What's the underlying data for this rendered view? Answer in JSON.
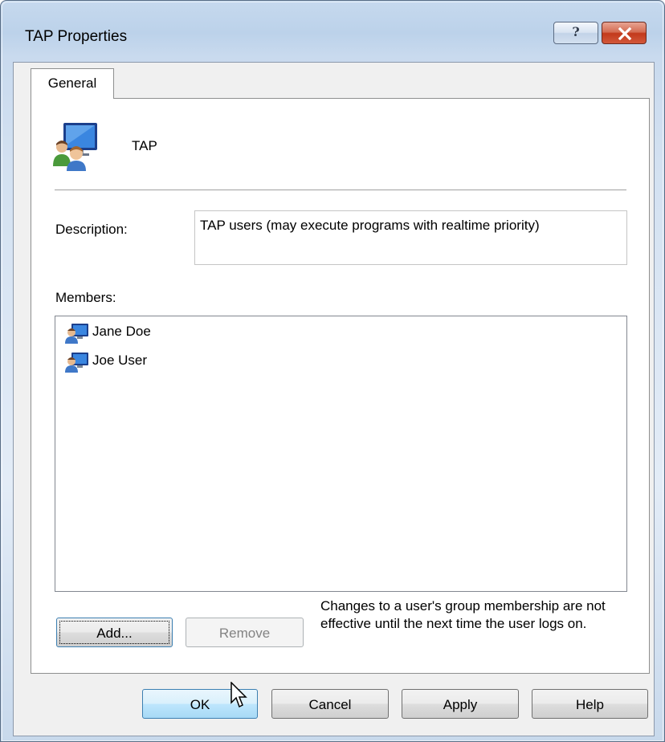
{
  "window": {
    "title": "TAP Properties",
    "help_button": "?",
    "close_icon": "close-icon"
  },
  "tabs": [
    {
      "label": "General",
      "selected": true
    }
  ],
  "group": {
    "icon": "users-group-icon",
    "name": "TAP"
  },
  "description": {
    "label": "Description:",
    "value": "TAP users (may execute programs with realtime priority)"
  },
  "members": {
    "label": "Members:",
    "items": [
      {
        "name": "Jane Doe",
        "icon": "user-icon"
      },
      {
        "name": "Joe User",
        "icon": "user-icon"
      }
    ]
  },
  "actions": {
    "add_label": "Add...",
    "remove_label": "Remove",
    "note": "Changes to a user's group membership are not effective until the next time the user logs on."
  },
  "footer": {
    "ok_label": "OK",
    "cancel_label": "Cancel",
    "apply_label": "Apply",
    "help_label": "Help"
  },
  "colors": {
    "title_gradient_top": "#c6d9ee",
    "close_red": "#c2391b",
    "hover_blue": "#bee6fd"
  }
}
